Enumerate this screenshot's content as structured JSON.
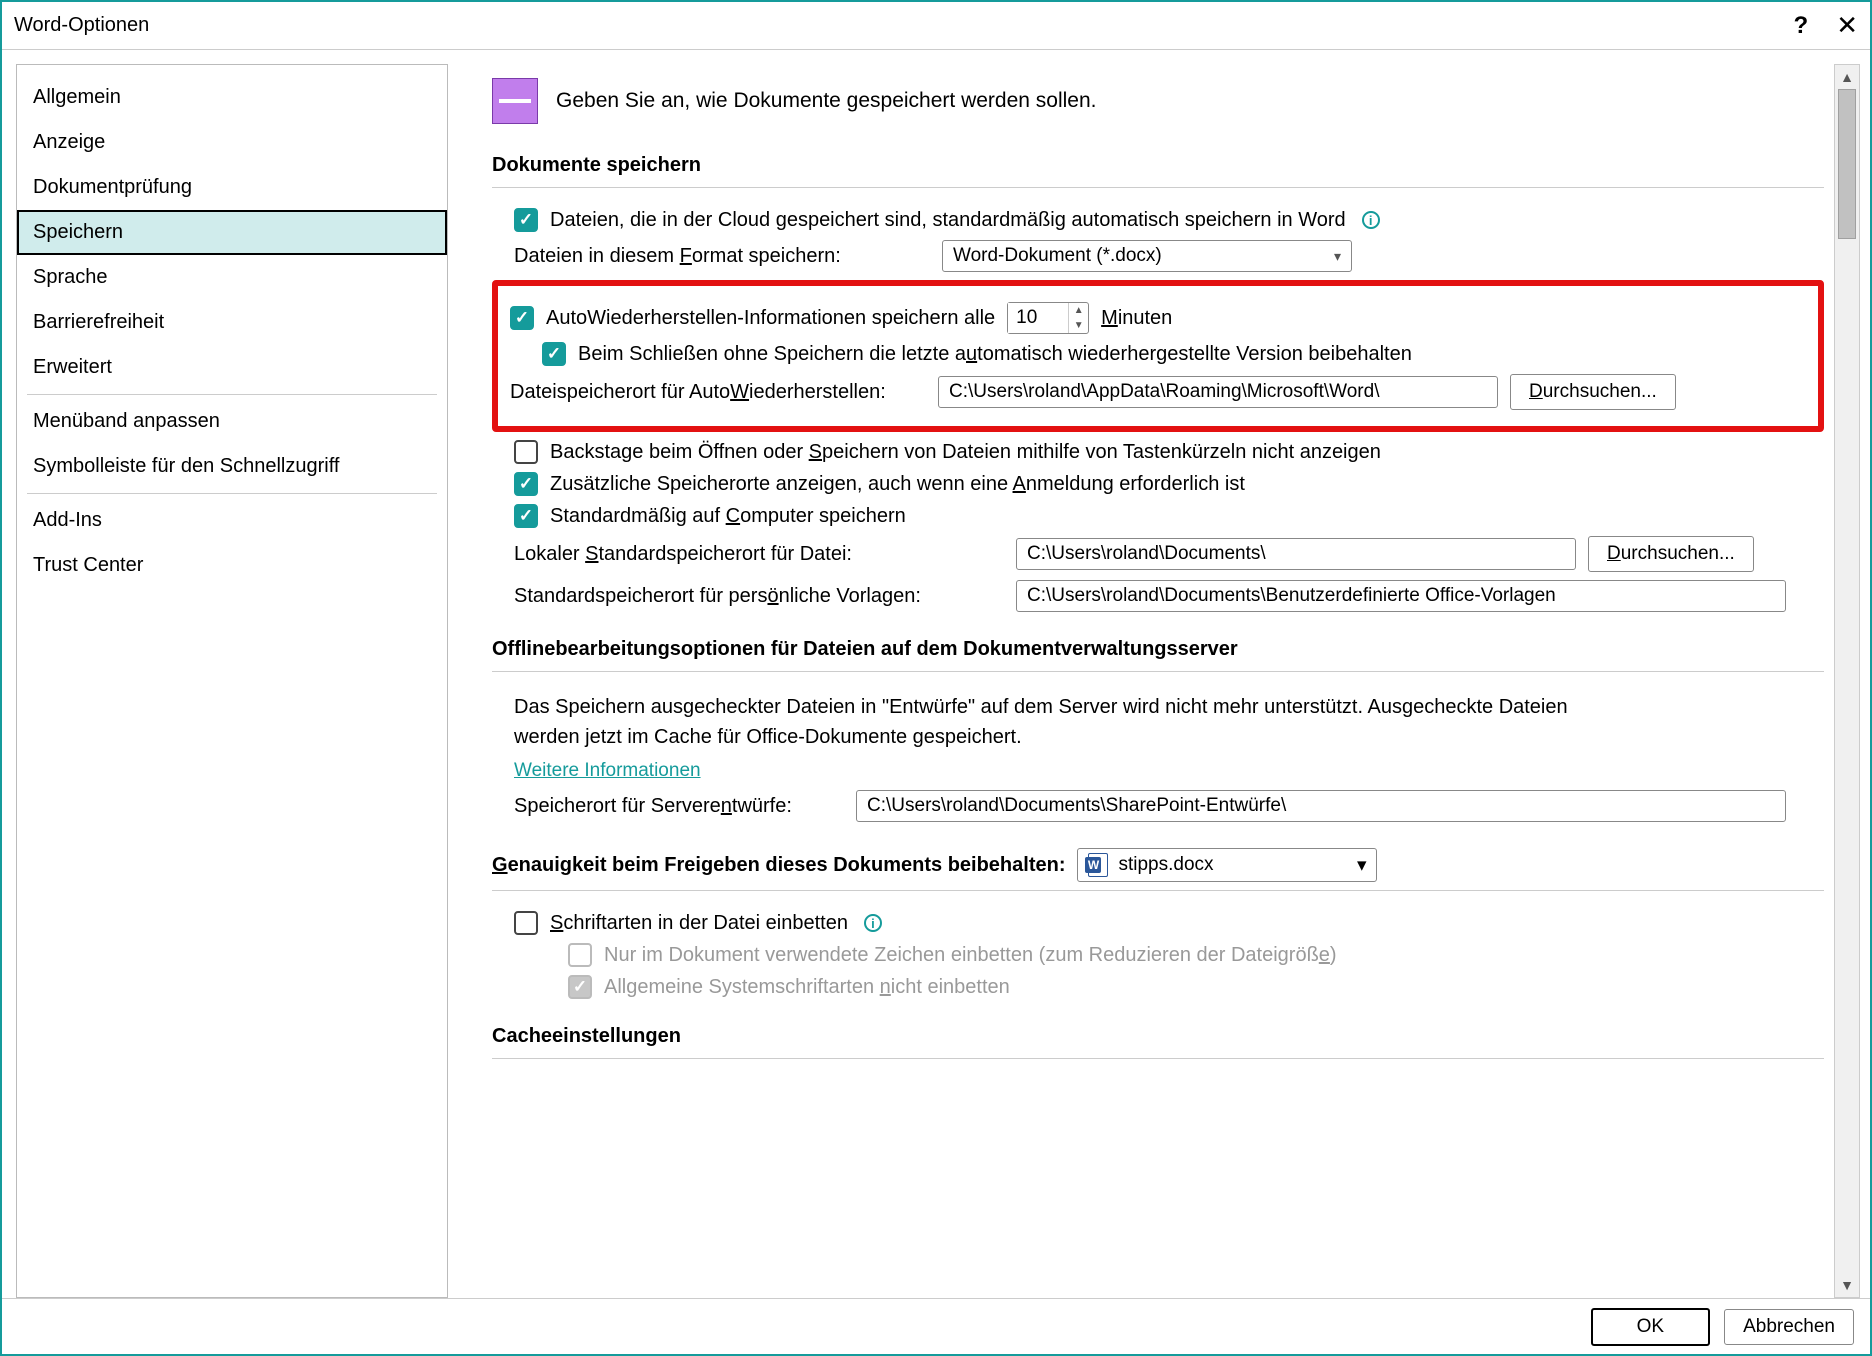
{
  "window": {
    "title": "Word-Optionen"
  },
  "buttons": {
    "ok": "OK",
    "cancel": "Abbrechen",
    "browse": "Durchsuchen..."
  },
  "sidebar": [
    "Allgemein",
    "Anzeige",
    "Dokumentprüfung",
    "Speichern",
    "Sprache",
    "Barrierefreiheit",
    "Erweitert",
    "Menüband anpassen",
    "Symbolleiste für den Schnellzugriff",
    "Add-Ins",
    "Trust Center"
  ],
  "sidebar_active_index": 3,
  "header": {
    "text": "Geben Sie an, wie Dokumente gespeichert werden sollen."
  },
  "section1": {
    "title": "Dokumente speichern",
    "cloud_autosave": "Dateien, die in der Cloud gespeichert sind, standardmäßig automatisch speichern in Word",
    "format_label": "Dateien in diesem Format speichern:",
    "format_value": "Word-Dokument (*.docx)",
    "autorecover_prefix": "AutoWiederherstellen-Informationen speichern alle",
    "autorecover_minutes": "10",
    "autorecover_suffix": "Minuten",
    "keep_last_autosaved": "Beim Schließen ohne Speichern die letzte automatisch wiederhergestellte Version beibehalten",
    "autorecover_location_label": "Dateispeicherort für AutoWiederherstellen:",
    "autorecover_location_value": "C:\\Users\\roland\\AppData\\Roaming\\Microsoft\\Word\\",
    "backstage_hide": "Backstage beim Öffnen oder Speichern von Dateien mithilfe von Tastenkürzeln nicht anzeigen",
    "show_additional_locations": "Zusätzliche Speicherorte anzeigen, auch wenn eine Anmeldung erforderlich ist",
    "default_to_computer": "Standardmäßig auf Computer speichern",
    "local_default_label": "Lokaler Standardspeicherort für Datei:",
    "local_default_value": "C:\\Users\\roland\\Documents\\",
    "personal_templates_label": "Standardspeicherort für persönliche Vorlagen:",
    "personal_templates_value": "C:\\Users\\roland\\Documents\\Benutzerdefinierte Office-Vorlagen"
  },
  "section2": {
    "title": "Offlinebearbeitungsoptionen für Dateien auf dem Dokumentverwaltungsserver",
    "note": "Das Speichern ausgecheckter Dateien in \"Entwürfe\" auf dem Server wird nicht mehr unterstützt. Ausgecheckte Dateien werden jetzt im Cache für Office-Dokumente gespeichert.",
    "more_info": "Weitere Informationen",
    "server_drafts_label": "Speicherort für Serverentwürfe:",
    "server_drafts_value": "C:\\Users\\roland\\Documents\\SharePoint-Entwürfe\\"
  },
  "section3": {
    "title": "Genauigkeit beim Freigeben dieses Dokuments beibehalten:",
    "document_name": "stipps.docx",
    "embed_fonts": "Schriftarten in der Datei einbetten",
    "embed_used_only": "Nur im Dokument verwendete Zeichen einbetten (zum Reduzieren der Dateigröße)",
    "exclude_common": "Allgemeine Systemschriftarten nicht einbetten"
  },
  "section4": {
    "title": "Cacheeinstellungen"
  }
}
